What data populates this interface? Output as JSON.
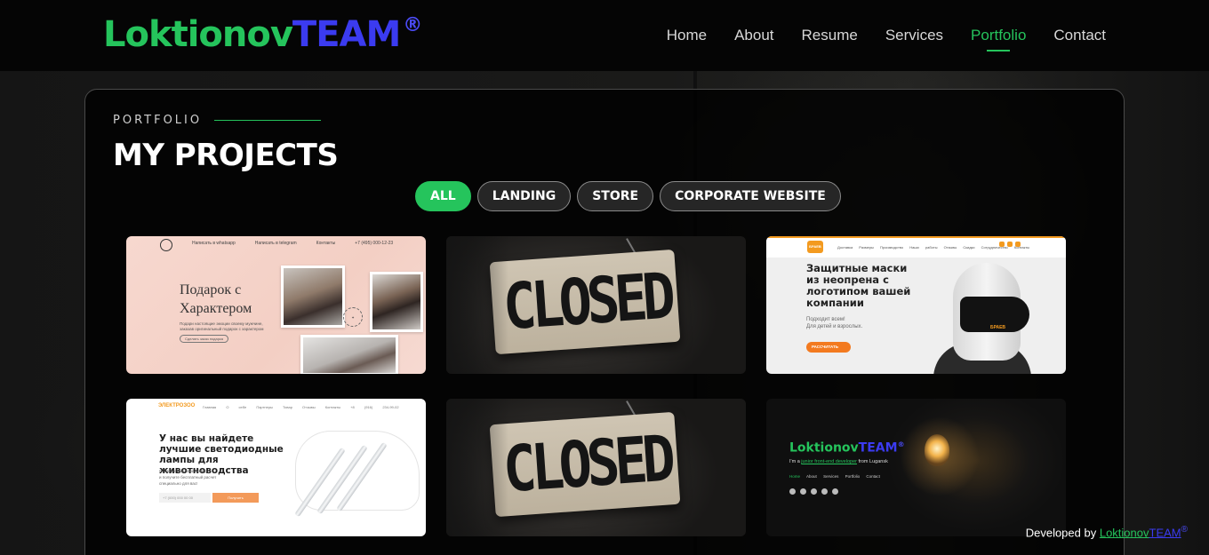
{
  "brand": {
    "part1": "Loktionov",
    "part2": "TEAM",
    "registered": "®",
    "colors": {
      "green": "#25c45c",
      "blue": "#3b3bf0"
    }
  },
  "nav": {
    "items": [
      "Home",
      "About",
      "Resume",
      "Services",
      "Portfolio",
      "Contact"
    ],
    "active": "Portfolio"
  },
  "portfolio": {
    "label": "PORTFOLIO",
    "title": "MY PROJECTS",
    "filters": [
      "ALL",
      "LANDING",
      "STORE",
      "CORPORATE WEBSITE"
    ],
    "active_filter": "ALL"
  },
  "projects": [
    {
      "type": "gift-landing",
      "top_links": [
        "Написать в whatsapp",
        "Написать в telegram",
        "Контакты",
        "+7 (495) 000-12-23"
      ],
      "heading": "Подарок с Характером",
      "text": "Подари настоящие эмоции своему мужчине, заказав оригинальный подарок с характером",
      "button": "Сделать заказ подарка"
    },
    {
      "type": "closed",
      "sign": "CLOSED"
    },
    {
      "type": "masks-store",
      "logo": "БРАЕВ",
      "links": "Доставка Размеры Производство Наши работы Отзывы Скидки Сотрудничество Контакты",
      "heading": "Защитные маски из неопрена с логотипом вашей компании",
      "text_line1": "Подходит всем!",
      "text_line2": "Для детей и взрослых.",
      "button": "РАССЧИТАТЬ",
      "mask_brand": "БРАЕВ"
    },
    {
      "type": "lamps-landing",
      "logo": "ЭЛЕКТРОЗОО",
      "links": "Главная О себе Партнеры Товар Отзывы Контакты",
      "phone": "+8 (916) 234-99-02",
      "heading": "У нас вы найдете лучшие светодиодные лампы для животноводства",
      "text_line1": "Оставьте нам свой номер,",
      "text_line2": "и получите бесплатный расчет",
      "text_line3": "специально для вас!",
      "input_placeholder": "+7 (000) 000 00 00",
      "button": "Получить"
    },
    {
      "type": "closed",
      "sign": "CLOSED"
    },
    {
      "type": "portfolio-site",
      "logo_part1": "Loktionov",
      "logo_part2": "TEAM",
      "logo_reg": "®",
      "subtitle_pre": "I'm a",
      "subtitle_highlight": "junior front-end developer",
      "subtitle_post": "from Lugansk",
      "links": [
        "Home",
        "About",
        "Services",
        "Portfolio",
        "Contact"
      ]
    }
  ],
  "footer": {
    "developed_by": "Developed by",
    "brand_part1": "Loktionov",
    "brand_part2": "TEAM",
    "registered": "®"
  }
}
